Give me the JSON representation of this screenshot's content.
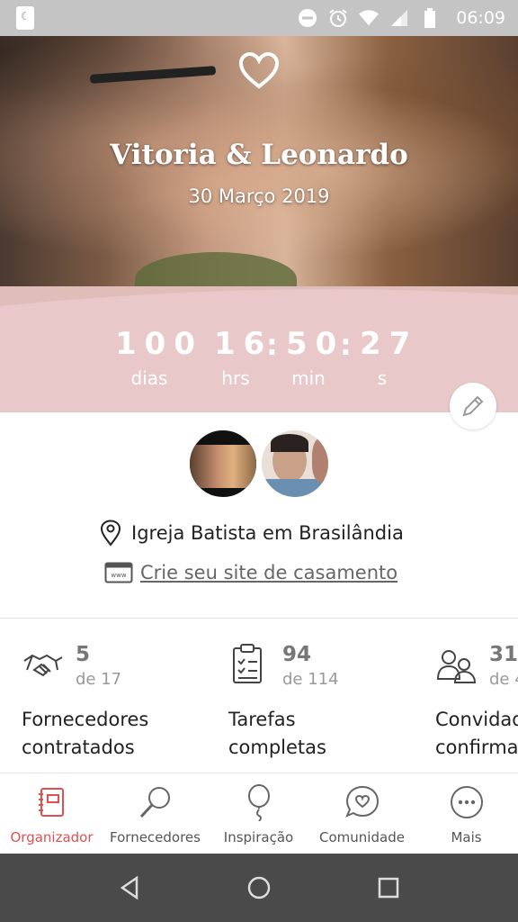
{
  "status_bar": {
    "time": "06:09"
  },
  "hero": {
    "couple_name": "Vitoria & Leonardo",
    "date": "30 Março 2019"
  },
  "countdown": {
    "days": "100",
    "hours": "16",
    "minutes": "50",
    "seconds": "27",
    "days_label": "dias",
    "hours_label": "hrs",
    "minutes_label": "min",
    "seconds_label": "s"
  },
  "venue": {
    "location": "Igreja Batista em Brasilândia",
    "site_link": "Crie seu site de casamento"
  },
  "stats": [
    {
      "icon": "handshake-icon",
      "count": "5",
      "total": "de 17",
      "label_line1": "Fornecedores",
      "label_line2": "contratados"
    },
    {
      "icon": "checklist-icon",
      "count": "94",
      "total": "de 114",
      "label_line1": "Tarefas",
      "label_line2": "completas"
    },
    {
      "icon": "guests-icon",
      "count": "31",
      "total": "de 4",
      "label_line1": "Convidad",
      "label_line2": "confirma"
    }
  ],
  "bottom_nav": [
    {
      "label": "Organizador",
      "icon": "planner-icon",
      "active": true
    },
    {
      "label": "Fornecedores",
      "icon": "search-icon",
      "active": false
    },
    {
      "label": "Inspiração",
      "icon": "balloon-icon",
      "active": false
    },
    {
      "label": "Comunidade",
      "icon": "chat-heart-icon",
      "active": false
    },
    {
      "label": "Mais",
      "icon": "more-icon",
      "active": false
    }
  ],
  "colors": {
    "accent": "#e05050",
    "countdown_bg": "#e8c8c8",
    "status_bar_bg": "#c4c4c4",
    "android_nav_bg": "#4a4a4a"
  }
}
